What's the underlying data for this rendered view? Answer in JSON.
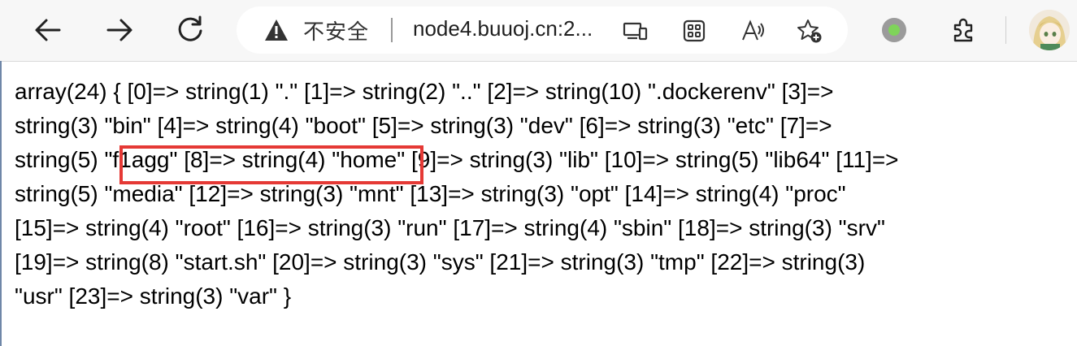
{
  "browser": {
    "security_label": "不安全",
    "url": "node4.buuoj.cn:2...",
    "icons": [
      "back-icon",
      "forward-icon",
      "refresh-icon",
      "warning-icon",
      "device-icon",
      "apps-icon",
      "read-aloud-icon",
      "favorite-add-icon",
      "extension-status-icon",
      "extensions-icon",
      "profile-avatar"
    ],
    "colors": {
      "toolbar": "#f7f7f7",
      "highlight": "#e53935",
      "extension_dot": "#7fd45a"
    }
  },
  "page": {
    "lines": [
      "array(24) { [0]=> string(1) \".\" [1]=> string(2) \"..\" [2]=> string(10) \".dockerenv\" [3]=>",
      "string(3) \"bin\" [4]=> string(4) \"boot\" [5]=> string(3) \"dev\" [6]=> string(3) \"etc\" [7]=>",
      "string(5) \"f1agg\" [8]=> string(4) \"home\" [9]=> string(3) \"lib\" [10]=> string(5) \"lib64\" [11]=>",
      "string(5) \"media\" [12]=> string(3) \"mnt\" [13]=> string(3) \"opt\" [14]=> string(4) \"proc\"",
      "[15]=> string(4) \"root\" [16]=> string(3) \"run\" [17]=> string(4) \"sbin\" [18]=> string(3) \"srv\"",
      "[19]=> string(8) \"start.sh\" [20]=> string(3) \"sys\" [21]=> string(3) \"tmp\" [22]=> string(3)",
      "\"usr\" [23]=> string(3) \"var\" }"
    ]
  }
}
